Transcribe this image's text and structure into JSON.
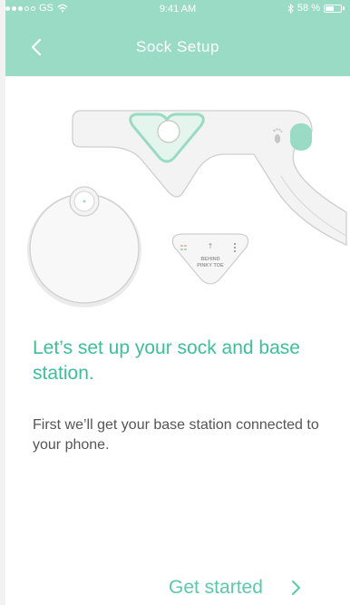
{
  "status_bar": {
    "carrier": "GS",
    "time": "9:41 AM",
    "battery": "58 %",
    "battery_level": 0.58,
    "icons": [
      "signal-dots-icon",
      "wifi-icon",
      "bluetooth-icon",
      "battery-icon"
    ]
  },
  "header": {
    "title": "Sock Setup",
    "back_icon": "chevron-left-icon"
  },
  "illustration": {
    "pad_label_line1": "BEHIND",
    "pad_label_line2": "PINKY TOE",
    "pad_arrow": "↑"
  },
  "main": {
    "headline": "Let’s set up your sock and base station.",
    "description": "First we’ll get your base station connected to your phone."
  },
  "footer": {
    "cta_label": "Get started",
    "cta_icon": "chevron-right-icon"
  },
  "colors": {
    "brand": "#9adbc6",
    "accent_text": "#3dbf98",
    "body_text": "#555555"
  }
}
